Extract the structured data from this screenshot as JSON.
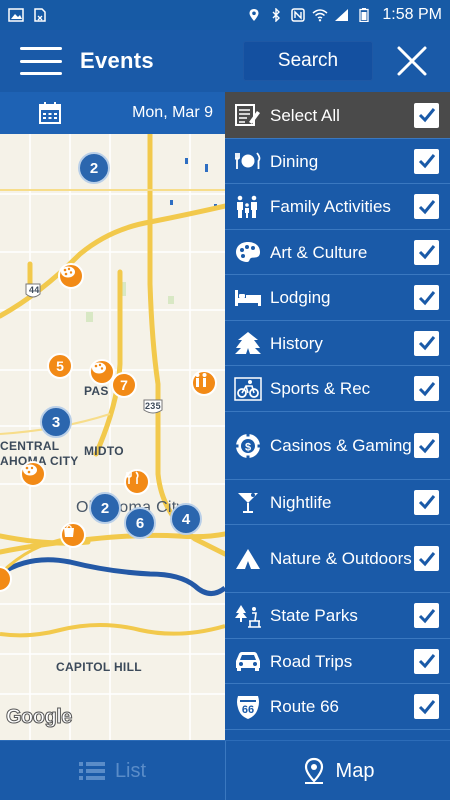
{
  "status_bar": {
    "time": "1:58 PM"
  },
  "header": {
    "title": "Events",
    "search_label": "Search"
  },
  "date_bar": {
    "date": "Mon, Mar 9"
  },
  "map": {
    "labels": [
      "CENTRAL",
      "AHOMA CITY",
      "PAS",
      "MIDTO",
      "Oklahoma City",
      "CAPITOL HILL",
      "44",
      "235"
    ],
    "clusters": [
      "2",
      "3",
      "2",
      "6",
      "4"
    ],
    "orange_counts": [
      "5",
      "7"
    ],
    "attribution": "Google"
  },
  "categories": {
    "select_all": "Select All",
    "items": [
      {
        "label": "Dining",
        "icon": "dining-icon"
      },
      {
        "label": "Family Activities",
        "icon": "family-icon"
      },
      {
        "label": "Art & Culture",
        "icon": "palette-icon"
      },
      {
        "label": "Lodging",
        "icon": "bed-icon"
      },
      {
        "label": "History",
        "icon": "tent-icon"
      },
      {
        "label": "Sports & Rec",
        "icon": "bike-icon"
      },
      {
        "label": "Casinos & Gaming",
        "icon": "chip-icon"
      },
      {
        "label": "Nightlife",
        "icon": "cocktail-icon"
      },
      {
        "label": "Nature & Outdoors",
        "icon": "campsite-icon"
      },
      {
        "label": "State Parks",
        "icon": "park-icon"
      },
      {
        "label": "Road Trips",
        "icon": "car-icon"
      },
      {
        "label": "Route 66",
        "icon": "route66-icon"
      }
    ],
    "checked": true
  },
  "bottom_nav": {
    "list_label": "List",
    "map_label": "Map"
  },
  "colors": {
    "primary": "#1a5aa8",
    "select_all_bg": "#4a4a4a",
    "marker_orange": "#f28a16",
    "map_bg": "#f5f2e8"
  }
}
